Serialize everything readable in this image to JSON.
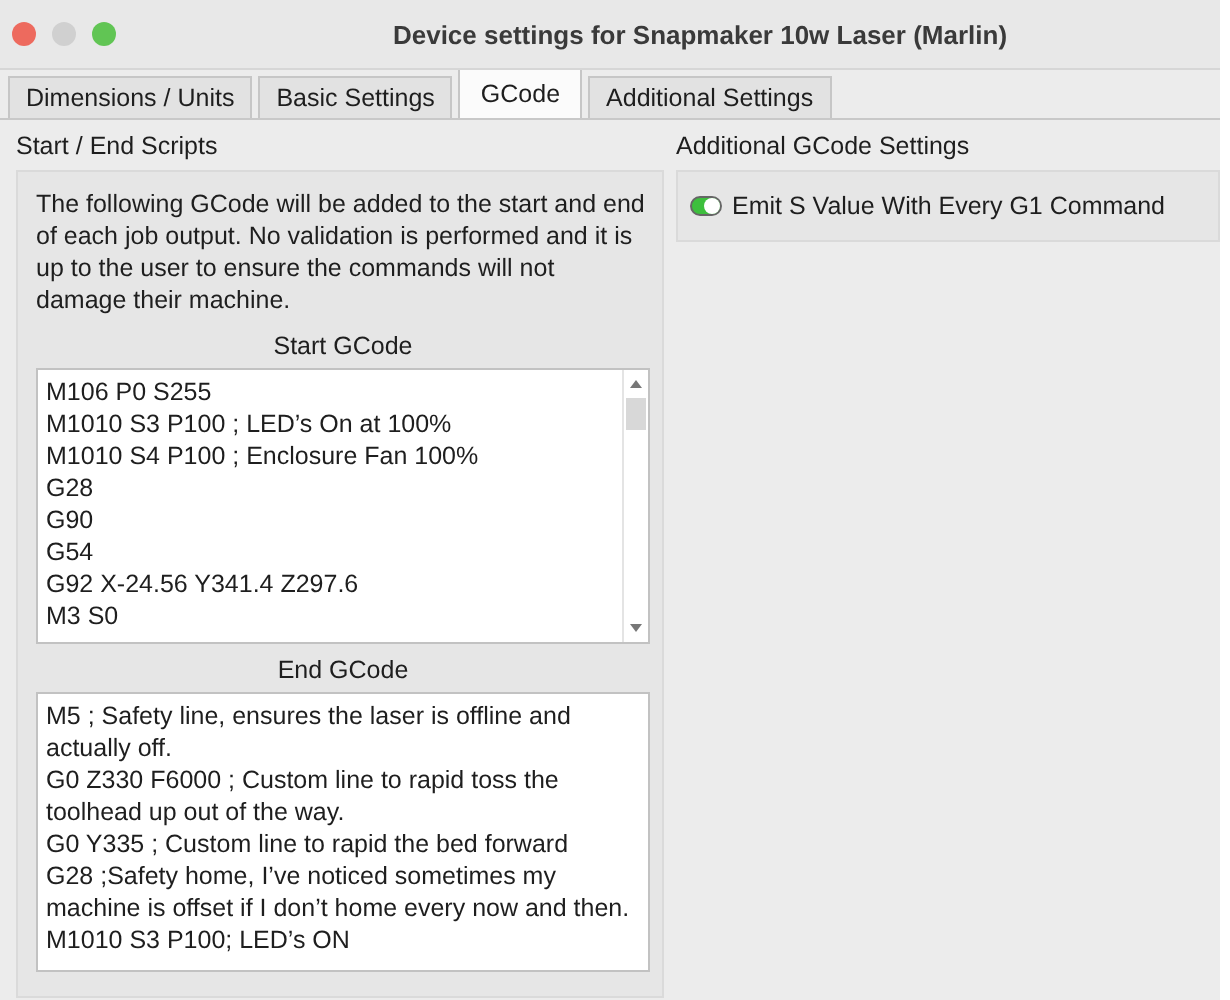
{
  "window": {
    "title": "Device settings for Snapmaker 10w Laser (Marlin)"
  },
  "tabs": [
    {
      "label": "Dimensions / Units",
      "selected": false
    },
    {
      "label": "Basic Settings",
      "selected": false
    },
    {
      "label": "GCode",
      "selected": true
    },
    {
      "label": "Additional Settings",
      "selected": false
    }
  ],
  "scripts": {
    "heading": "Start / End Scripts",
    "description": "The following GCode will be added to the start and end of each job output. No validation is performed and it is up to the user to ensure the commands will not damage their machine.",
    "start_label": "Start GCode",
    "start_lines": [
      "M106 P0 S255",
      "M1010 S3 P100 ; LED’s On at 100%",
      "M1010 S4 P100 ; Enclosure Fan 100%",
      "G28",
      "G90",
      "G54",
      "G92 X-24.56 Y341.4 Z297.6",
      "M3 S0"
    ],
    "end_label": "End GCode",
    "end_lines": [
      "M5 ; Safety line, ensures the laser is offline and actually off.",
      "G0 Z330 F6000 ; Custom line to rapid toss the toolhead up out of the way.",
      "G0 Y335 ; Custom line to rapid the bed forward",
      "G28 ;Safety home, I’ve noticed sometimes my machine is offset if I don’t home every now and then.",
      "M1010 S3 P100; LED’s ON"
    ]
  },
  "additional": {
    "heading": "Additional GCode Settings",
    "options": [
      {
        "label": "Emit S Value With Every G1 Command",
        "on": true
      }
    ]
  }
}
